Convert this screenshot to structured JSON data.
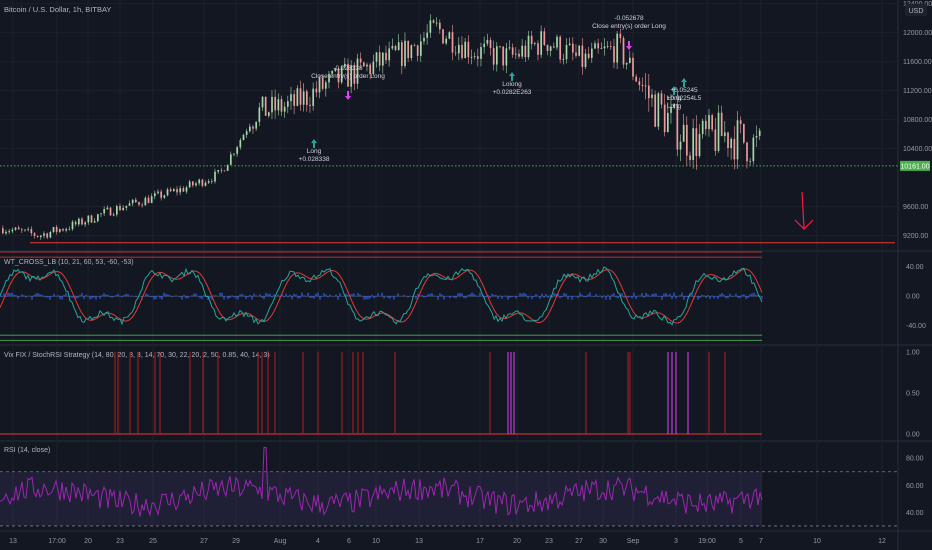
{
  "header": {
    "symbol": "Bitcoin / U.S. Dollar, 1h, BITBAY",
    "currency": "USD"
  },
  "colors": {
    "background": "#131722",
    "up": "#a5d6a7",
    "down": "#ef9a9a",
    "level_line": "#4caf50",
    "support_red": "#e53935",
    "wave_red": "#e53935",
    "wave_green": "#26a69a",
    "wave_blue": "#2962ff",
    "rsi": "#9c27b0",
    "long_arrow": "#26a69a",
    "close_arrow": "#e040fb",
    "annotation_arrow": "#ff1744"
  },
  "price_panel": {
    "y_ticks": [
      "12400.00",
      "12000.00",
      "11600.00",
      "11200.00",
      "10800.00",
      "10400.00",
      "9600.00",
      "9200.00"
    ],
    "current_price_label": "10161.00",
    "level_price": 10161,
    "support_price": 9100,
    "annotations": [
      {
        "label": "Long",
        "value": "+0.028338"
      },
      {
        "label": "-0.028338",
        "value": "Close entry(s) order Long"
      },
      {
        "label": "Lolong",
        "value": "+0.0282E263"
      },
      {
        "label": "-0.052678",
        "value": "Close entry(s) order Long"
      },
      {
        "label": "Long",
        "value": "Long"
      },
      {
        "label": "+0.05245",
        "value": "+0.02254L5"
      }
    ]
  },
  "wt_panel": {
    "title": "WT_CROSS_LB (10, 21, 60, 53, -60, -53)",
    "y_ticks": [
      "40.00",
      "0.00",
      "-40.00"
    ]
  },
  "vix_panel": {
    "title": "Vix FIX / StochRSI Strategy (14, 80, 20, 3, 3, 14, 70, 30, 22, 20, 2, 50, 0.85, 40, 14, 3)",
    "y_ticks": [
      "1.00",
      "0.50",
      "0.00"
    ]
  },
  "rsi_panel": {
    "title": "RSI (14, close)",
    "y_ticks": [
      "80.00",
      "60.00",
      "40.00"
    ]
  },
  "x_axis": {
    "labels": [
      "13",
      "17:00",
      "20",
      "23",
      "25",
      "27",
      "29",
      "Aug",
      "4",
      "6",
      "10",
      "13",
      "17",
      "20",
      "23",
      "27",
      "30",
      "Sep",
      "3",
      "19:00",
      "5",
      "7",
      "10",
      "12"
    ]
  },
  "chart_data": [
    {
      "type": "candlestick",
      "title": "Bitcoin / U.S. Dollar, 1h, BITBAY",
      "x_labels": [
        "13",
        "17:00",
        "20",
        "23",
        "25",
        "27",
        "29",
        "Aug",
        "4",
        "6",
        "10",
        "13",
        "17",
        "20",
        "23",
        "27",
        "30",
        "Sep",
        "3",
        "19:00",
        "5",
        "7"
      ],
      "approx_close": [
        9300,
        9200,
        9350,
        9550,
        9700,
        9850,
        10050,
        10900,
        11000,
        11300,
        11500,
        11700,
        12050,
        11750,
        11650,
        11900,
        11600,
        11800,
        11000,
        10500,
        10600,
        10400
      ],
      "ylim": [
        9000,
        12450
      ],
      "grid": true
    },
    {
      "type": "line",
      "title": "WT_CROSS_LB (10, 21, 60, 53, -60, -53)",
      "ylim": [
        -65,
        60
      ]
    },
    {
      "type": "bar",
      "title": "Vix FIX / StochRSI Strategy (14, 80, 20, 3, 3, 14, 70, 30, 22, 20, 2, 50, 0.85, 40, 14, 3)",
      "ylim": [
        0,
        1
      ]
    },
    {
      "type": "line",
      "title": "RSI (14, close)",
      "ylim": [
        27,
        92
      ]
    }
  ]
}
